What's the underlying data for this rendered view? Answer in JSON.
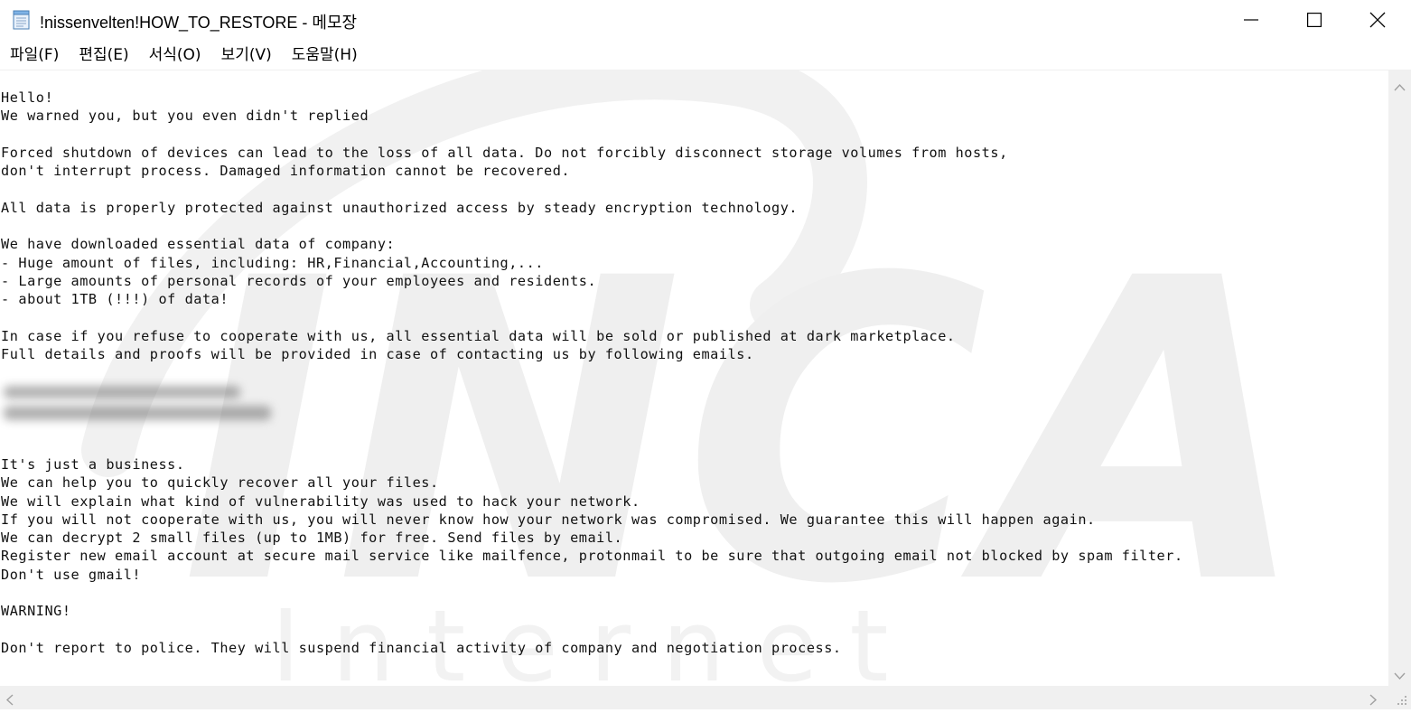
{
  "window": {
    "title": "!nissenvelten!HOW_TO_RESTORE - 메모장",
    "icon": "notepad-icon"
  },
  "menu": {
    "items": [
      "파일(F)",
      "편집(E)",
      "서식(O)",
      "보기(V)",
      "도움말(H)"
    ]
  },
  "document": {
    "text": "Hello!\nWe warned you, but you even didn't replied\n\nForced shutdown of devices can lead to the loss of all data. Do not forcibly disconnect storage volumes from hosts,\ndon't interrupt process. Damaged information cannot be recovered.\n\nAll data is properly protected against unauthorized access by steady encryption technology.\n\nWe have downloaded essential data of company:\n- Huge amount of files, including: HR,Financial,Accounting,...\n- Large amounts of personal records of your employees and residents.\n- about 1TB (!!!) of data!\n\nIn case if you refuse to cooperate with us, all essential data will be sold or published at dark marketplace.\nFull details and proofs will be provided in case of contacting us by following emails.\n\n\n\n\n\nIt's just a business.\nWe can help you to quickly recover all your files.\nWe will explain what kind of vulnerability was used to hack your network.\nIf you will not cooperate with us, you will never know how your network was compromised. We guarantee this will happen again.\nWe can decrypt 2 small files (up to 1MB) for free. Send files by email.\nRegister new email account at secure mail service like mailfence, protonmail to be sure that outgoing email not blocked by spam filter.\nDon't use gmail!\n\nWARNING!\n\nDon't report to police. They will suspend financial activity of company and negotiation process."
  },
  "watermark": {
    "big": "INCA",
    "small": "I n t e r n e t"
  },
  "colors": {
    "background": "#ffffff",
    "text": "#111111",
    "scrollbar": "#f0f0f0",
    "watermark": "#ebebeb"
  }
}
